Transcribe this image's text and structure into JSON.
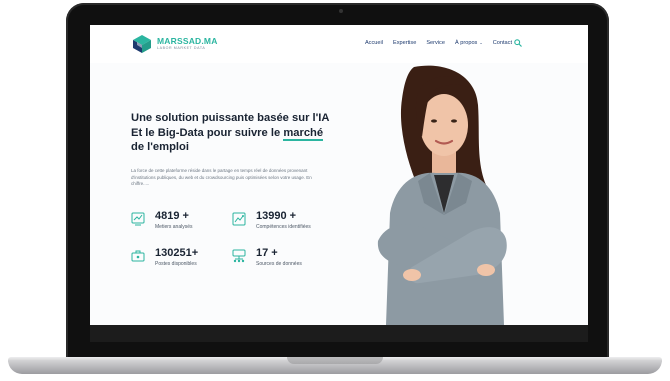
{
  "brand": {
    "name": "MARSSAD.MA",
    "tagline": "LABOR MARKET DATA",
    "accent_color": "#2bb5a0",
    "dark_color": "#1a2433"
  },
  "nav": {
    "items": [
      {
        "label": "Accueil"
      },
      {
        "label": "Expertise"
      },
      {
        "label": "Service"
      },
      {
        "label": "À propos"
      },
      {
        "label": "Contact"
      }
    ],
    "search_icon": "search-icon",
    "dropdown_icon": "chevron-down-icon"
  },
  "hero": {
    "headline_part1": "Une solution puissante basée sur l'IA Et le Big-Data pour suivre le ",
    "headline_underlined": "marché",
    "headline_part2": " de l'emploi",
    "description": "La force de cette plateforme réside dans le partage en temps réel de données provenant d'institutions publiques, du web et du crowdsourcing puis optimisées selon votre usage. En chiffre.....",
    "stats": [
      {
        "value": "4819 +",
        "label": "Metiers analysés",
        "icon": "chart-icon"
      },
      {
        "value": "13990 +",
        "label": "Compétences identifiées",
        "icon": "skills-icon"
      },
      {
        "value": "130251+",
        "label": "Postes disponibles",
        "icon": "briefcase-icon"
      },
      {
        "value": "17 +",
        "label": "Sources de données",
        "icon": "data-source-icon"
      }
    ]
  }
}
